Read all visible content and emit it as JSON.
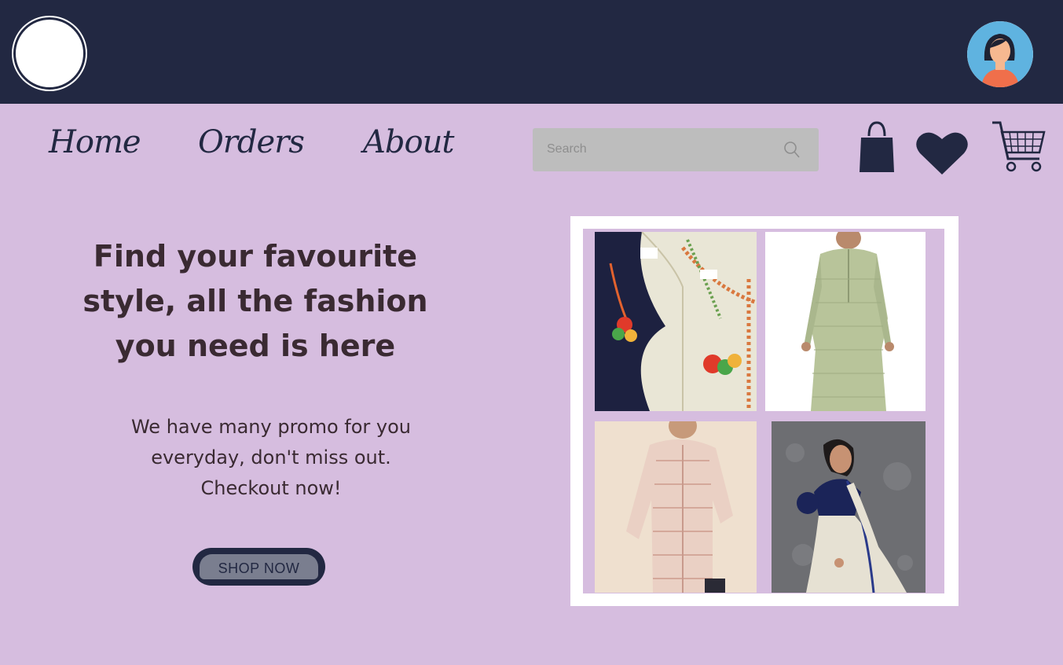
{
  "nav": {
    "home": "Home",
    "orders": "Orders",
    "about": "About"
  },
  "search": {
    "placeholder": "Search"
  },
  "hero": {
    "title_line1": "Find your favourite",
    "title_line2": "style, all the fashion",
    "title_line3": "you need is here",
    "sub_line1": "We have many promo for you",
    "sub_line2": "everyday, don't miss out.",
    "sub_line3": "Checkout now!",
    "button_label": "SHOP NOW"
  },
  "icons": {
    "bag": "shopping-bag-icon",
    "heart": "heart-icon",
    "cart": "cart-icon",
    "search": "search-icon",
    "avatar": "user-avatar"
  },
  "colors": {
    "header_bg": "#222842",
    "page_bg": "#d6bddf",
    "search_bg": "#bdbdbd",
    "text_dark": "#3a2a32"
  }
}
